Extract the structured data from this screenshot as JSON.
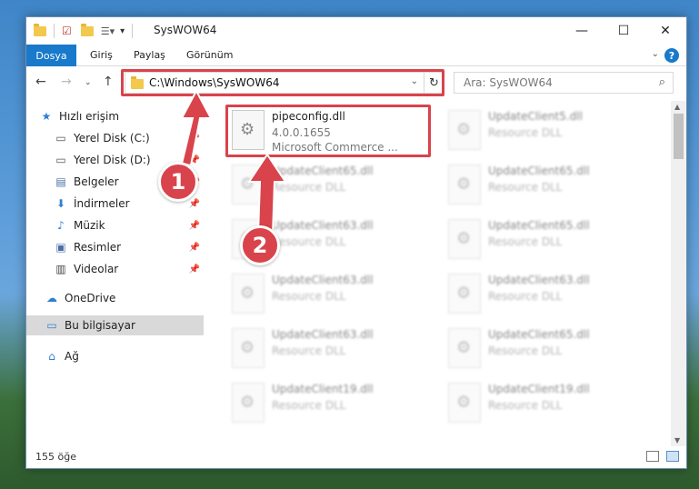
{
  "window": {
    "title": "SysWOW64"
  },
  "ribbon": {
    "tabs": [
      "Dosya",
      "Giriş",
      "Paylaş",
      "Görünüm"
    ]
  },
  "nav": {
    "address_path": "C:\\Windows\\SysWOW64",
    "search_placeholder": "Ara: SysWOW64"
  },
  "sidebar": {
    "items": [
      {
        "label": "Hızlı erişim",
        "icon": "star-icon",
        "pinned": false
      },
      {
        "label": "Yerel Disk (C:)",
        "icon": "drive-icon",
        "pinned": true
      },
      {
        "label": "Yerel Disk (D:)",
        "icon": "drive-icon",
        "pinned": true
      },
      {
        "label": "Belgeler",
        "icon": "document-icon",
        "pinned": true
      },
      {
        "label": "İndirmeler",
        "icon": "download-icon",
        "pinned": true
      },
      {
        "label": "Müzik",
        "icon": "music-icon",
        "pinned": true
      },
      {
        "label": "Resimler",
        "icon": "picture-icon",
        "pinned": true
      },
      {
        "label": "Videolar",
        "icon": "video-icon",
        "pinned": true
      },
      {
        "label": "OneDrive",
        "icon": "cloud-icon",
        "pinned": false
      },
      {
        "label": "Bu bilgisayar",
        "icon": "computer-icon",
        "pinned": false,
        "selected": true
      },
      {
        "label": "Ağ",
        "icon": "network-icon",
        "pinned": false
      }
    ]
  },
  "files": [
    {
      "name": "pipeconfig.dll",
      "version": "4.0.0.1655",
      "desc": "Microsoft Commerce ..."
    },
    {
      "name": "UpdateClient5.dll",
      "desc": "Resource DLL"
    },
    {
      "name": "UpdateClient65.dll",
      "desc": "Resource DLL"
    },
    {
      "name": "UpdateClient65.dll",
      "desc": "Resource DLL"
    },
    {
      "name": "UpdateClient63.dll",
      "desc": "Resource DLL"
    },
    {
      "name": "UpdateClient65.dll",
      "desc": "Resource DLL"
    },
    {
      "name": "UpdateClient63.dll",
      "desc": "Resource DLL"
    },
    {
      "name": "UpdateClient63.dll",
      "desc": "Resource DLL"
    },
    {
      "name": "UpdateClient63.dll",
      "desc": "Resource DLL"
    },
    {
      "name": "UpdateClient65.dll",
      "desc": "Resource DLL"
    },
    {
      "name": "UpdateClient19.dll",
      "desc": "Resource DLL"
    },
    {
      "name": "UpdateClient19.dll",
      "desc": "Resource DLL"
    }
  ],
  "status": {
    "count": "155 öğe"
  },
  "annotations": {
    "badge1": "1",
    "badge2": "2"
  },
  "colors": {
    "accent": "#1979ca",
    "highlight": "#d9434b"
  }
}
